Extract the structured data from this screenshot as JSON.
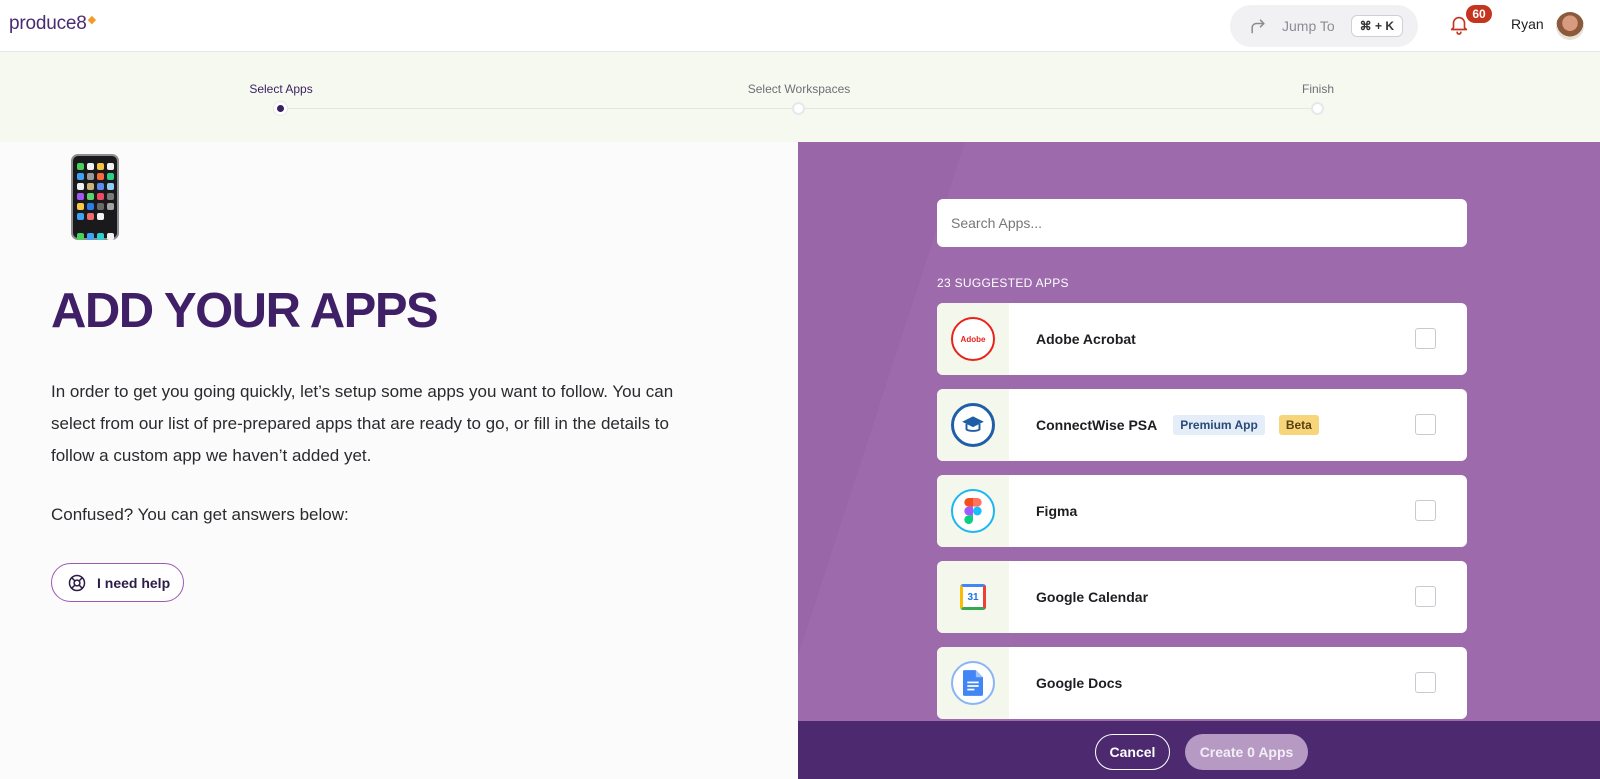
{
  "header": {
    "logo_text": "produce8",
    "jump_label": "Jump To",
    "jump_shortcut": "⌘ + K",
    "notification_count": "60",
    "user_name": "Ryan"
  },
  "stepper": {
    "steps": [
      {
        "label": "Select Apps",
        "active": true
      },
      {
        "label": "Select Workspaces",
        "active": false
      },
      {
        "label": "Finish",
        "active": false
      }
    ]
  },
  "intro": {
    "headline": "ADD YOUR APPS",
    "description": "In order to get you going quickly, let’s setup some apps you want to follow. You can select from our list of pre-prepared apps that are ready to go, or fill in the details to follow a custom app we haven’t added yet.",
    "confused_text": "Confused? You can get answers below:",
    "help_label": "I need help"
  },
  "apps_panel": {
    "search_placeholder": "Search Apps...",
    "suggested_label": "23 SUGGESTED APPS",
    "apps": [
      {
        "name": "Adobe Acrobat",
        "icon": "adobe-acrobat-icon",
        "logo_text": "Adobe",
        "checked": false
      },
      {
        "name": "ConnectWise PSA",
        "icon": "connectwise-icon",
        "tags": [
          "Premium App",
          "Beta"
        ],
        "checked": false
      },
      {
        "name": "Figma",
        "icon": "figma-icon",
        "checked": false
      },
      {
        "name": "Google Calendar",
        "icon": "google-calendar-icon",
        "logo_text": "31",
        "checked": false
      },
      {
        "name": "Google Docs",
        "icon": "google-docs-icon",
        "checked": false
      }
    ]
  },
  "footer": {
    "cancel_label": "Cancel",
    "create_label": "Create 0 Apps"
  },
  "colors": {
    "brand_purple": "#3f2066",
    "panel_purple": "#9966a8",
    "footer_purple": "#4d2a6f",
    "stepper_bg": "#f6f9ef",
    "notification_red": "#c4341f"
  }
}
